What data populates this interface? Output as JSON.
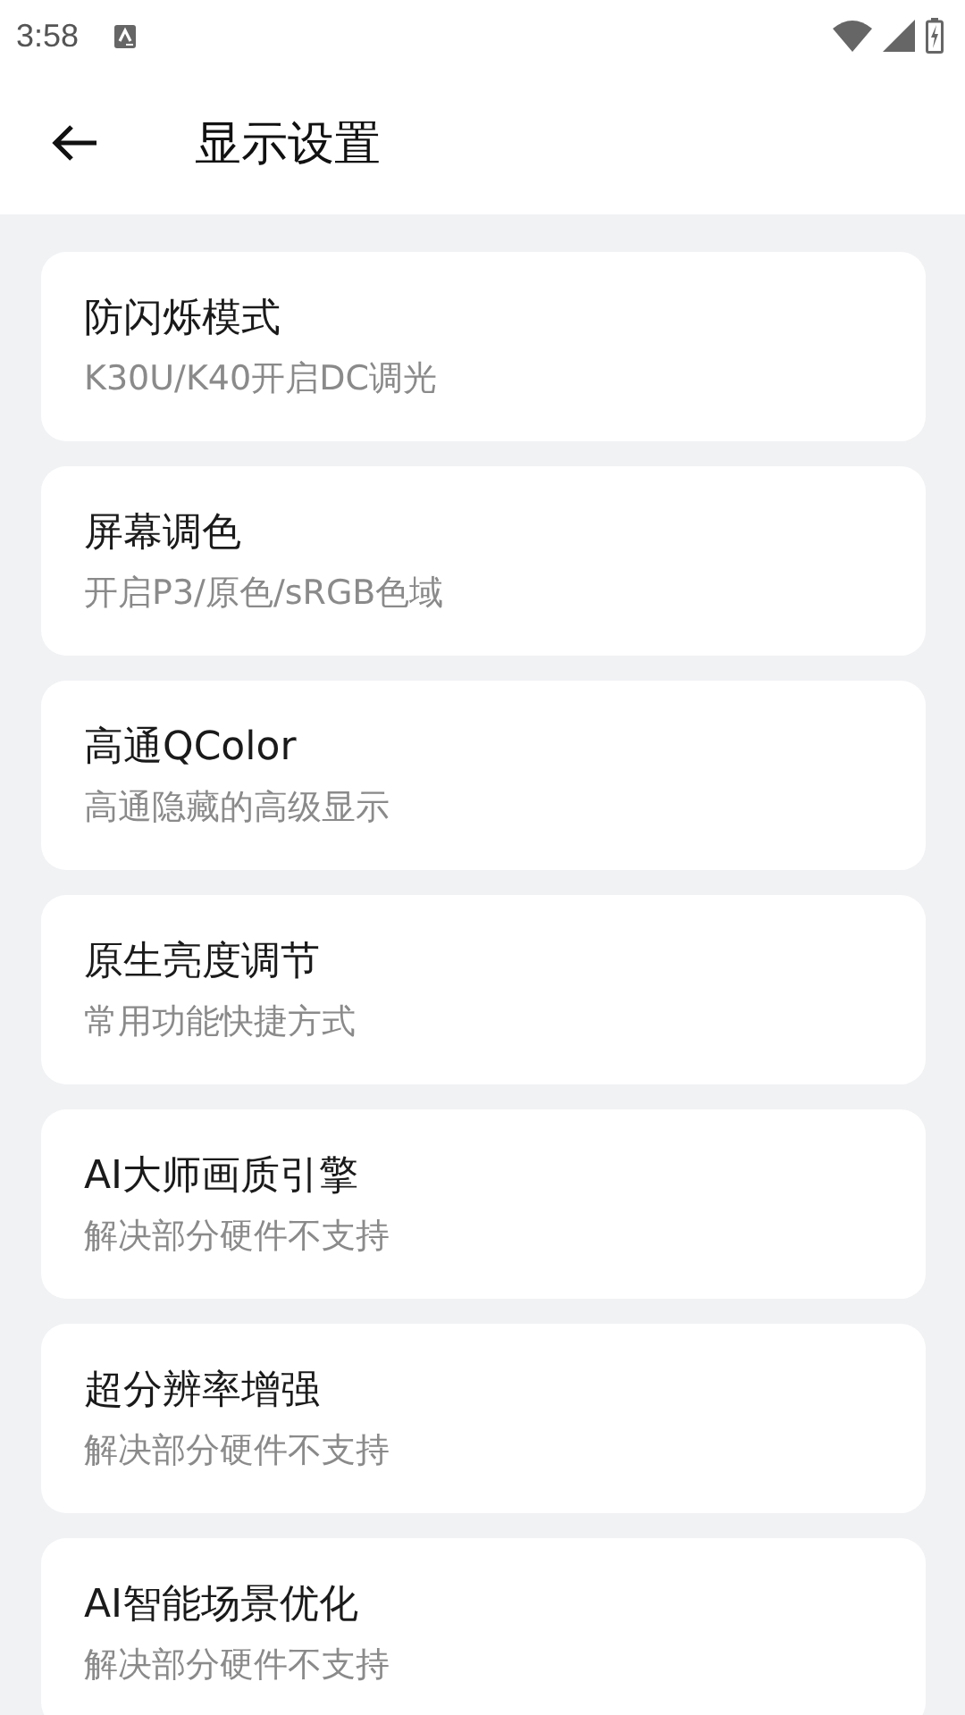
{
  "status_bar": {
    "time": "3:58"
  },
  "header": {
    "title": "显示设置"
  },
  "items": [
    {
      "title": "防闪烁模式",
      "subtitle": "K30U/K40开启DC调光"
    },
    {
      "title": "屏幕调色",
      "subtitle": "开启P3/原色/sRGB色域"
    },
    {
      "title": "高通QColor",
      "subtitle": "高通隐藏的高级显示"
    },
    {
      "title": "原生亮度调节",
      "subtitle": "常用功能快捷方式"
    },
    {
      "title": "AI大师画质引擎",
      "subtitle": "解决部分硬件不支持"
    },
    {
      "title": "超分辨率增强",
      "subtitle": "解决部分硬件不支持"
    },
    {
      "title": "AI智能场景优化",
      "subtitle": "解决部分硬件不支持"
    }
  ]
}
